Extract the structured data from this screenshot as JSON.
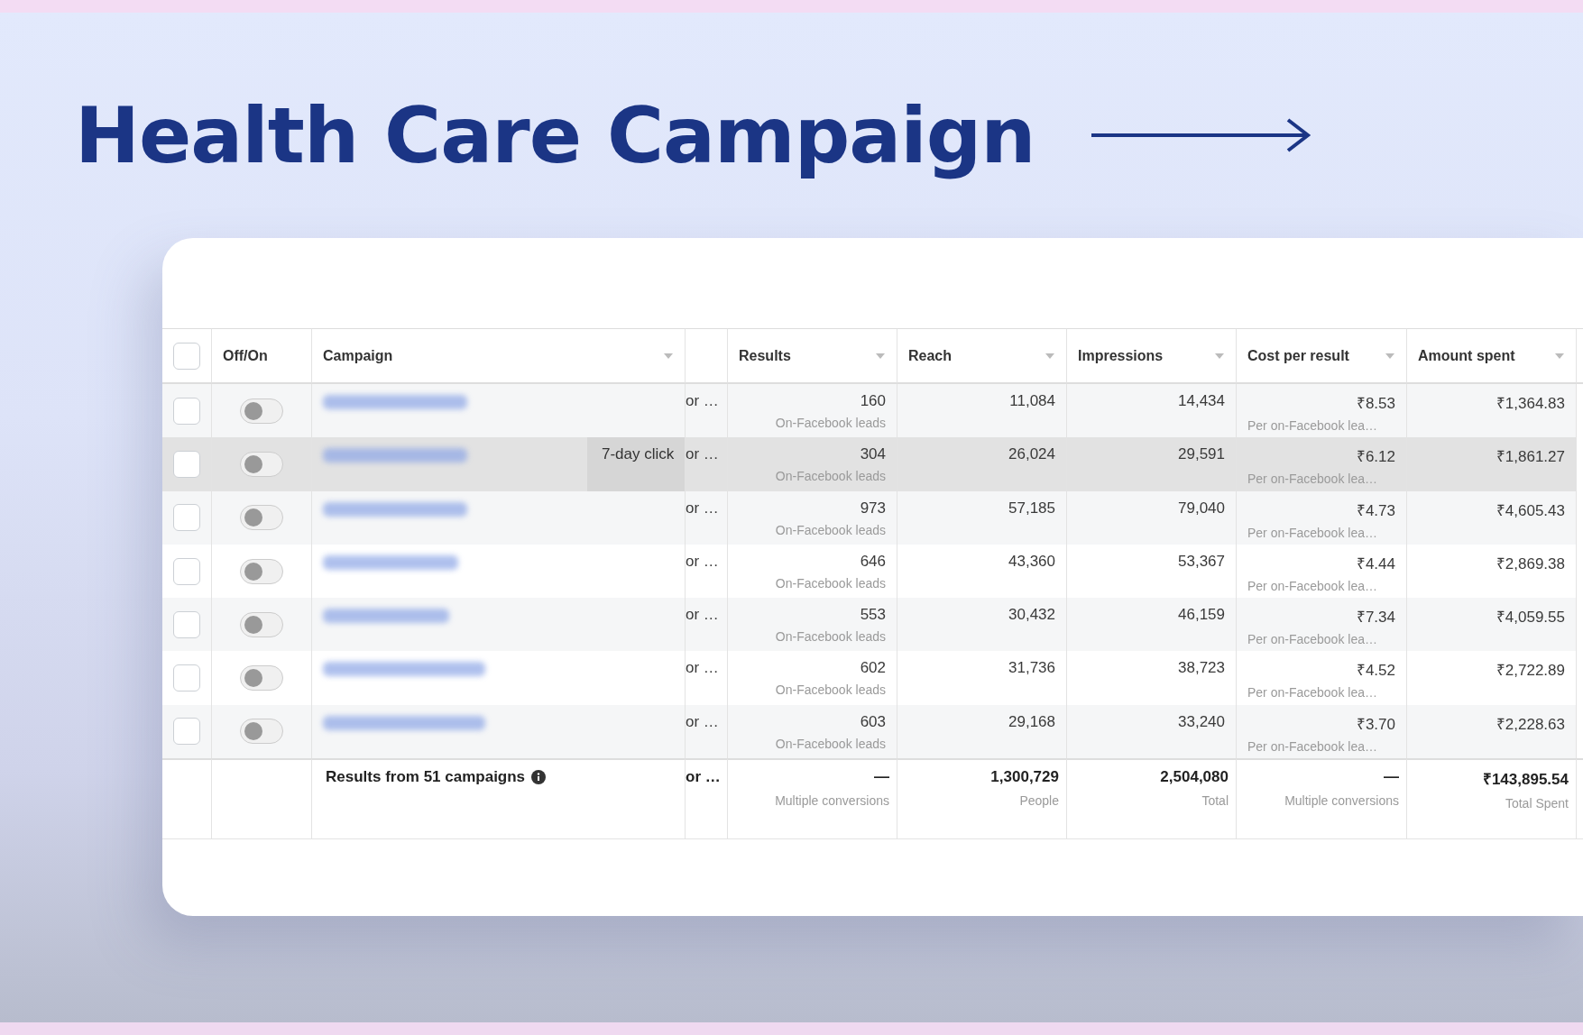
{
  "title": "Health Care Campaign",
  "table": {
    "select_all": {
      "checked": false
    },
    "columns": [
      {
        "label": "Off/On",
        "sort_menu": false
      },
      {
        "label": "Campaign",
        "sort_menu": true
      },
      {
        "label": "Results",
        "sort_menu": true
      },
      {
        "label": "Reach",
        "sort_menu": true
      },
      {
        "label": "Impressions",
        "sort_menu": true
      },
      {
        "label": "Cost per result",
        "sort_menu": true
      },
      {
        "label": "Amount spent",
        "sort_menu": true
      }
    ],
    "rows": [
      {
        "checked": false,
        "on": false,
        "highlighted": false,
        "column_4": "or …",
        "results": "160",
        "results_note": "On-Facebook leads",
        "reach": "11,084",
        "impressions": "14,434",
        "cost_per_result": "₹8.53",
        "cost_note": "Per on-Facebook lea…",
        "amount_spent": "₹1,364.83"
      },
      {
        "checked": false,
        "on": false,
        "highlighted": true,
        "tooltip": "7-day click",
        "column_4": "or …",
        "results": "304",
        "results_note": "On-Facebook leads",
        "reach": "26,024",
        "impressions": "29,591",
        "cost_per_result": "₹6.12",
        "cost_note": "Per on-Facebook lea…",
        "amount_spent": "₹1,861.27"
      },
      {
        "checked": false,
        "on": false,
        "highlighted": false,
        "column_4": "or …",
        "results": "973",
        "results_note": "On-Facebook leads",
        "reach": "57,185",
        "impressions": "79,040",
        "cost_per_result": "₹4.73",
        "cost_note": "Per on-Facebook lea…",
        "amount_spent": "₹4,605.43"
      },
      {
        "checked": false,
        "on": false,
        "highlighted": false,
        "column_4": "or …",
        "results": "646",
        "results_note": "On-Facebook leads",
        "reach": "43,360",
        "impressions": "53,367",
        "cost_per_result": "₹4.44",
        "cost_note": "Per on-Facebook lea…",
        "amount_spent": "₹2,869.38"
      },
      {
        "checked": false,
        "on": false,
        "highlighted": false,
        "column_4": "or …",
        "results": "553",
        "results_note": "On-Facebook leads",
        "reach": "30,432",
        "impressions": "46,159",
        "cost_per_result": "₹7.34",
        "cost_note": "Per on-Facebook lea…",
        "amount_spent": "₹4,059.55"
      },
      {
        "checked": false,
        "on": false,
        "highlighted": false,
        "column_4": "or …",
        "results": "602",
        "results_note": "On-Facebook leads",
        "reach": "31,736",
        "impressions": "38,723",
        "cost_per_result": "₹4.52",
        "cost_note": "Per on-Facebook lea…",
        "amount_spent": "₹2,722.89"
      },
      {
        "checked": false,
        "on": false,
        "highlighted": false,
        "column_4": "or …",
        "results": "603",
        "results_note": "On-Facebook leads",
        "reach": "29,168",
        "impressions": "33,240",
        "cost_per_result": "₹3.70",
        "cost_note": "Per on-Facebook lea…",
        "amount_spent": "₹2,228.63"
      }
    ],
    "footer": {
      "label": "Results from 51 campaigns",
      "column_4": "or …",
      "results": "—",
      "results_note": "Multiple conversions",
      "reach": "1,300,729",
      "reach_note": "People",
      "impressions": "2,504,080",
      "impressions_note": "Total",
      "cost_per_result": "—",
      "cost_note": "Multiple conversions",
      "amount_spent": "₹143,895.54",
      "amount_note": "Total Spent"
    }
  }
}
